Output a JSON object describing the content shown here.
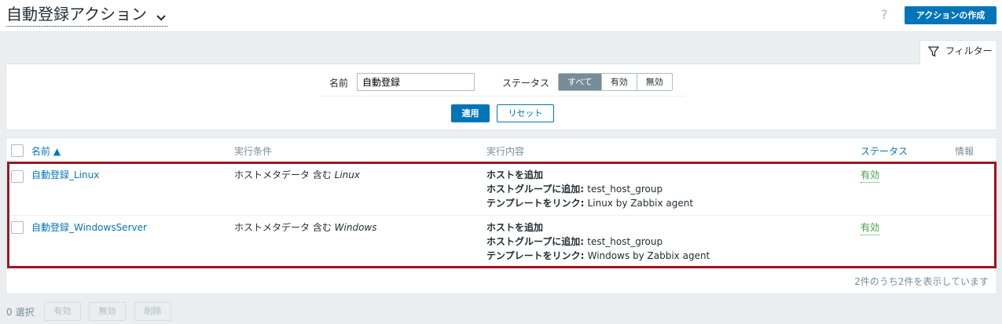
{
  "header": {
    "title": "自動登録アクション",
    "help_label": "?",
    "create_button": "アクションの作成"
  },
  "filter": {
    "tab_label": "フィルター",
    "name_label": "名前",
    "name_value": "自動登録",
    "status_label": "ステータス",
    "status_options": [
      "すべて",
      "有効",
      "無効"
    ],
    "status_selected": "すべて",
    "apply_button": "適用",
    "reset_button": "リセット"
  },
  "table": {
    "columns": {
      "name": "名前 ▲",
      "conditions": "実行条件",
      "operations": "実行内容",
      "status": "ステータス",
      "info": "情報"
    },
    "rows": [
      {
        "name": "自動登録_Linux",
        "condition_prefix": "ホストメタデータ 含む ",
        "condition_value": "Linux",
        "op1_label": "ホストを追加",
        "op2_label": "ホストグループに追加: ",
        "op2_value": "test_host_group",
        "op3_label": "テンプレートをリンク: ",
        "op3_value": "Linux by Zabbix agent",
        "status": "有効"
      },
      {
        "name": "自動登録_WindowsServer",
        "condition_prefix": "ホストメタデータ 含む ",
        "condition_value": "Windows",
        "op1_label": "ホストを追加",
        "op2_label": "ホストグループに追加: ",
        "op2_value": "test_host_group",
        "op3_label": "テンプレートをリンク: ",
        "op3_value": "Windows by Zabbix agent",
        "status": "有効"
      }
    ],
    "footer": "2件のうち2件を表示しています"
  },
  "bottom": {
    "selected": "0 選択",
    "enable_button": "有効",
    "disable_button": "無効",
    "delete_button": "削除"
  },
  "colors": {
    "accent": "#0275b8",
    "status_enabled": "#429e47",
    "highlight_border": "#a01521"
  }
}
